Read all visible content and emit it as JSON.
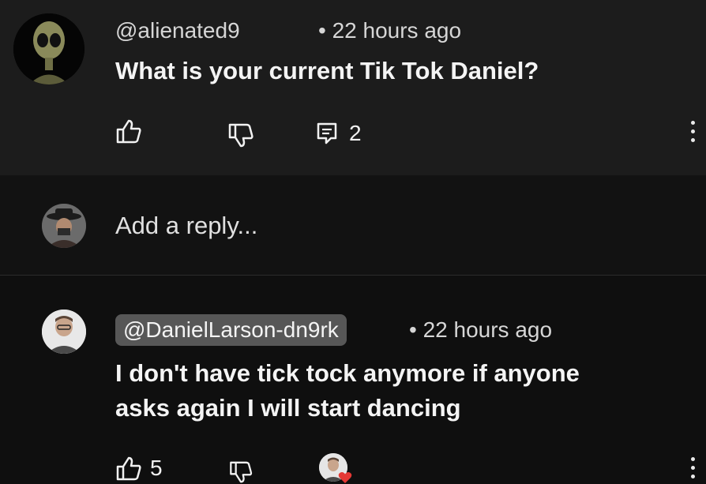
{
  "comment": {
    "author": "@alienated9",
    "time": "• 22 hours ago",
    "text": "What is your current Tik Tok Daniel?",
    "reply_count": "2"
  },
  "reply_box": {
    "placeholder": "Add a reply..."
  },
  "reply": {
    "author": "@DanielLarson-dn9rk",
    "time": "• 22 hours ago",
    "text_line1": "I don't have tick tock anymore if anyone",
    "text_line2": "asks again I will start dancing",
    "like_count": "5"
  },
  "colors": {
    "background": "#0f0f0f",
    "comment_background": "#1c1c1c",
    "author_chip": "#575757",
    "heart": "#e53935"
  }
}
